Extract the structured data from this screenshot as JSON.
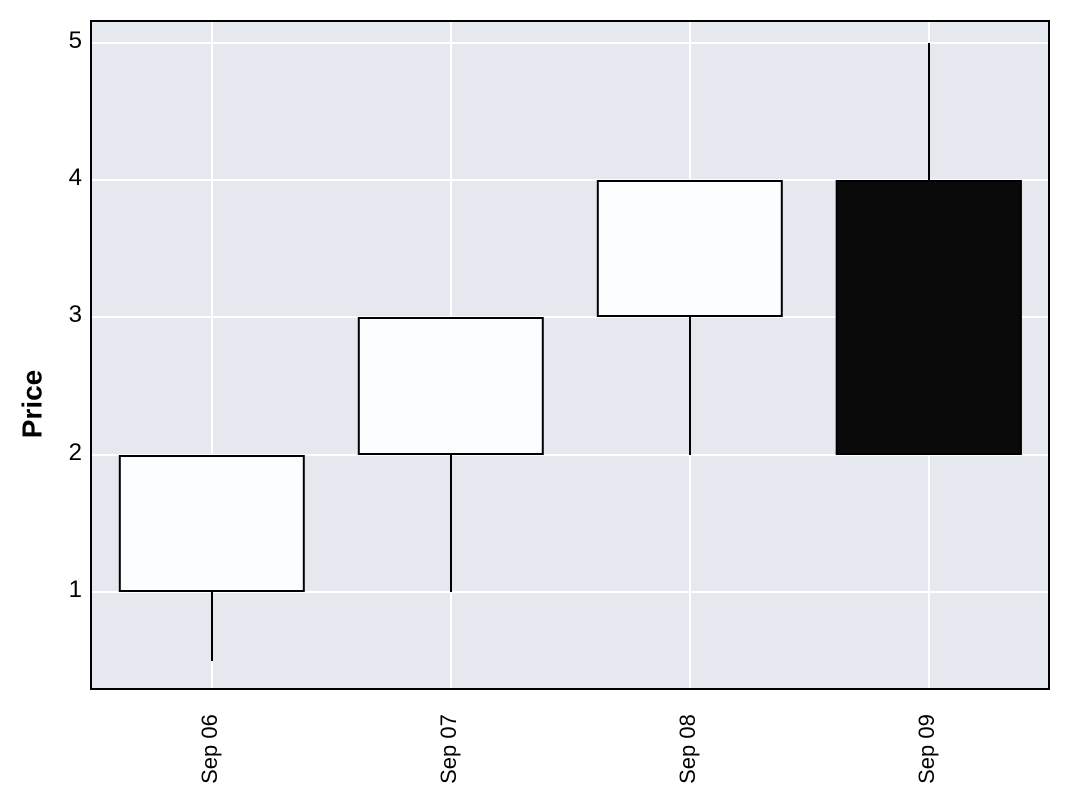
{
  "chart_data": {
    "type": "candlestick",
    "ylabel": "Price",
    "xlabel": "",
    "ylim": [
      0.3,
      5.15
    ],
    "y_ticks": [
      1,
      2,
      3,
      4,
      5
    ],
    "categories": [
      "Sep 06",
      "Sep 07",
      "Sep 08",
      "Sep 09"
    ],
    "series": [
      {
        "date": "Sep 06",
        "open": 1,
        "high": 2,
        "low": 0.5,
        "close": 2,
        "direction": "up"
      },
      {
        "date": "Sep 07",
        "open": 2,
        "high": 3,
        "low": 1,
        "close": 3,
        "direction": "up"
      },
      {
        "date": "Sep 08",
        "open": 3,
        "high": 4,
        "low": 2,
        "close": 4,
        "direction": "up"
      },
      {
        "date": "Sep 09",
        "open": 4,
        "high": 5,
        "low": 2,
        "close": 2,
        "direction": "down"
      }
    ],
    "colors": {
      "up": "#fcfdff",
      "down": "#0a0a0a",
      "grid_bg": "#e6e8ef"
    }
  }
}
